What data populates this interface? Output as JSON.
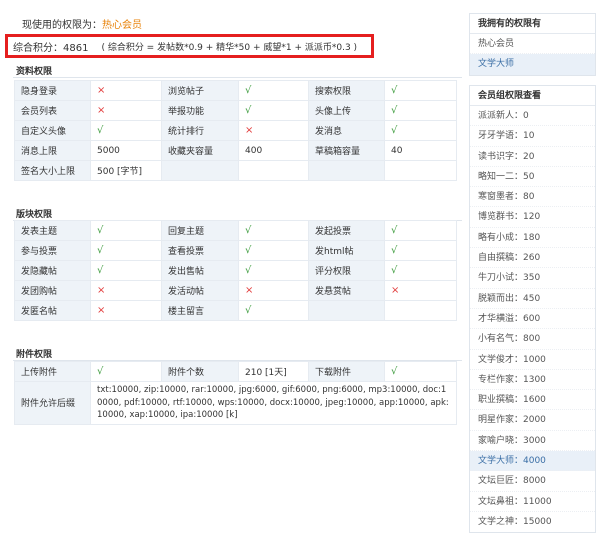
{
  "current": {
    "label": "现使用的权限为：",
    "group": "热心会员"
  },
  "score": {
    "label": "综合积分：4861",
    "formula": "( 综合积分 = 发帖数*0.9 + 精华*50 + 威望*1 + 派派币*0.3 )"
  },
  "sections": {
    "profile": {
      "title": "资料权限",
      "rows": [
        [
          {
            "k": "隐身登录",
            "v": "×"
          },
          {
            "k": "浏览帖子",
            "v": "√"
          },
          {
            "k": "搜索权限",
            "v": "√"
          }
        ],
        [
          {
            "k": "会员列表",
            "v": "×"
          },
          {
            "k": "举报功能",
            "v": "√"
          },
          {
            "k": "头像上传",
            "v": "√"
          }
        ],
        [
          {
            "k": "自定义头像",
            "v": "√"
          },
          {
            "k": "统计排行",
            "v": "×"
          },
          {
            "k": "发消息",
            "v": "√"
          }
        ],
        [
          {
            "k": "消息上限",
            "v": "5000"
          },
          {
            "k": "收藏夹容量",
            "v": "400"
          },
          {
            "k": "草稿箱容量",
            "v": "40"
          }
        ],
        [
          {
            "k": "签名大小上限",
            "v": "500 [字节]"
          }
        ]
      ]
    },
    "forum": {
      "title": "版块权限",
      "rows": [
        [
          {
            "k": "发表主题",
            "v": "√"
          },
          {
            "k": "回复主题",
            "v": "√"
          },
          {
            "k": "发起投票",
            "v": "√"
          }
        ],
        [
          {
            "k": "参与投票",
            "v": "√"
          },
          {
            "k": "查看投票",
            "v": "√"
          },
          {
            "k": "发html帖",
            "v": "√"
          }
        ],
        [
          {
            "k": "发隐藏帖",
            "v": "√"
          },
          {
            "k": "发出售帖",
            "v": "√"
          },
          {
            "k": "评分权限",
            "v": "√"
          }
        ],
        [
          {
            "k": "发团购帖",
            "v": "×"
          },
          {
            "k": "发活动帖",
            "v": "×"
          },
          {
            "k": "发悬赏帖",
            "v": "×"
          }
        ],
        [
          {
            "k": "发匿名帖",
            "v": "×"
          },
          {
            "k": "楼主留言",
            "v": "√"
          }
        ]
      ]
    },
    "attach": {
      "title": "附件权限",
      "rows": [
        [
          {
            "k": "上传附件",
            "v": "√"
          },
          {
            "k": "附件个数",
            "v": "210 [1天]"
          },
          {
            "k": "下载附件",
            "v": "√"
          }
        ]
      ],
      "types_label": "附件允许后缀",
      "types_value": "txt:10000, zip:10000, rar:10000, jpg:6000, gif:6000, png:6000, mp3:10000, doc:10000, pdf:10000, rtf:10000, wps:10000, docx:10000, jpeg:10000, app:10000, apk:10000, xap:10000, ipa:10000 [k]"
    }
  },
  "owned": {
    "title": "我拥有的权限有",
    "items": [
      "热心会员",
      "文学大师"
    ],
    "active": 1
  },
  "groups": {
    "title": "会员组权限查看",
    "items": [
      "派派新人：0",
      "牙牙学语：10",
      "读书识字：20",
      "略知一二：50",
      "寒窗墨者：80",
      "博览群书：120",
      "略有小成：180",
      "自由撰稿：260",
      "牛刀小试：350",
      "脱颖而出：450",
      "才华横溢：600",
      "小有名气：800",
      "文学俊才：1000",
      "专栏作家：1300",
      "职业撰稿：1600",
      "明星作家：2000",
      "家喻户晓：3000",
      "文学大师：4000",
      "文坛巨匠：8000",
      "文坛鼻祖：11000",
      "文学之神：15000"
    ],
    "active": 17
  },
  "colors": {
    "accent_orange": "#e8830b",
    "highlight_red": "#e51f1f",
    "yes_green": "#3c9b3c",
    "no_red": "#e23b3b"
  }
}
